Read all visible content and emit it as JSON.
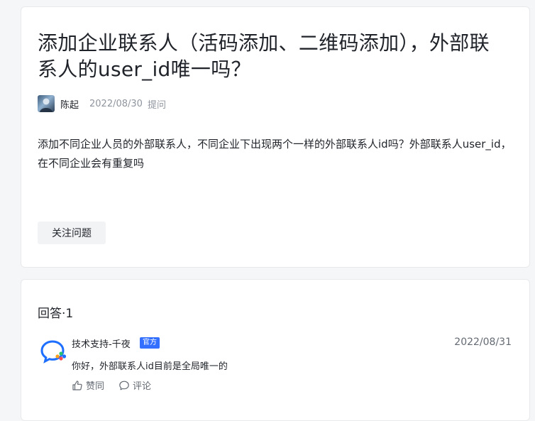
{
  "question": {
    "title": "添加企业联系人（活码添加、二维码添加），外部联系人的user_id唯一吗？",
    "author": "陈起",
    "date": "2022/08/30",
    "action": "提问",
    "body": "添加不同企业人员的外部联系人，不同企业下出现两个一样的外部联系人id吗？外部联系人user_id，在不同企业会有重复吗",
    "follow_label": "关注问题"
  },
  "answers": {
    "heading": "回答·1",
    "items": [
      {
        "author": "技术支持-千夜",
        "badge": "官方",
        "date": "2022/08/31",
        "text": "你好，外部联系人id目前是全局唯一的",
        "like_label": "赞同",
        "comment_label": "评论"
      }
    ]
  },
  "colors": {
    "accent": "#3370ff",
    "muted": "#8f959e"
  }
}
